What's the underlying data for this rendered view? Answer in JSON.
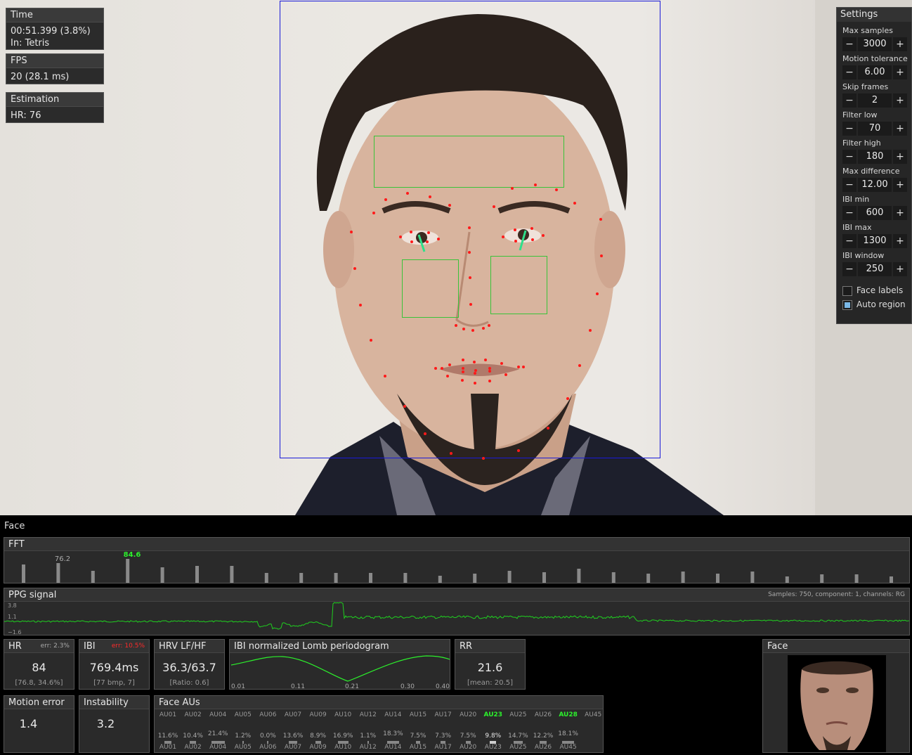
{
  "time_panel": {
    "title": "Time",
    "line1": "00:51.399 (3.8%)",
    "line2": "In: Tetris"
  },
  "fps_panel": {
    "title": "FPS",
    "value": "20 (28.1 ms)"
  },
  "estimation_panel": {
    "title": "Estimation",
    "value": "HR: 76"
  },
  "settings": {
    "title": "Settings",
    "fields": [
      {
        "label": "Max samples",
        "value": "3000"
      },
      {
        "label": "Motion tolerance",
        "value": "6.00"
      },
      {
        "label": "Skip frames",
        "value": "2"
      },
      {
        "label": "Filter low",
        "value": "70"
      },
      {
        "label": "Filter high",
        "value": "180"
      },
      {
        "label": "Max difference",
        "value": "12.00"
      },
      {
        "label": "IBI min",
        "value": "600"
      },
      {
        "label": "IBI max",
        "value": "1300"
      },
      {
        "label": "IBI window",
        "value": "250"
      }
    ],
    "minus": "−",
    "plus": "+",
    "face_labels": {
      "label": "Face labels",
      "checked": false
    },
    "auto_region": {
      "label": "Auto region",
      "checked": true
    }
  },
  "dashboard": {
    "section_label": "Face",
    "fft": {
      "title": "FFT",
      "peak1": "76.2",
      "peak2": "84.6",
      "peak2_color": "#2cf02c"
    },
    "ppg": {
      "title": "PPG signal",
      "info": "Samples: 750, component: 1, channels: RG",
      "y_top": "3.8",
      "y_mid": "1.1",
      "y_bot": "−1.6",
      "line_color": "#1fd01f"
    },
    "hr": {
      "title": "HR",
      "err": "err: 2.3%",
      "value": "84",
      "sub": "[76.8, 34.6%]"
    },
    "ibi": {
      "title": "IBI",
      "err": "err: 10.5%",
      "value": "769.4ms",
      "sub": "[77 bmp, 7]"
    },
    "hrv": {
      "title": "HRV LF/HF",
      "value": "36.3/63.7",
      "sub": "[Ratio: 0.6]"
    },
    "lomb": {
      "title": "IBI normalized Lomb periodogram",
      "ticks": [
        "0.01",
        "0.11",
        "0.21",
        "0.30",
        "0.40"
      ]
    },
    "rr": {
      "title": "RR",
      "value": "21.6",
      "sub": "[mean: 20.5]"
    },
    "face": {
      "title": "Face"
    },
    "motion_error": {
      "title": "Motion error",
      "value": "1.4"
    },
    "instability": {
      "title": "Instability",
      "value": "3.2"
    },
    "face_aus": {
      "title": "Face AUs",
      "top_labels": [
        "AU01",
        "AU02",
        "AU04",
        "AU05",
        "AU06",
        "AU07",
        "AU09",
        "AU10",
        "AU12",
        "AU14",
        "AU15",
        "AU17",
        "AU20",
        "AU23",
        "AU25",
        "AU26",
        "AU28",
        "AU45"
      ],
      "top_highlight": [
        "AU23",
        "AU28"
      ],
      "bars": [
        {
          "label": "AU01",
          "pct": "11.6%",
          "level": 11.6
        },
        {
          "label": "AU02",
          "pct": "10.4%",
          "level": 10.4
        },
        {
          "label": "AU04",
          "pct": "21.4%",
          "level": 21.4
        },
        {
          "label": "AU05",
          "pct": "1.2%",
          "level": 1.2
        },
        {
          "label": "AU06",
          "pct": "0.0%",
          "level": 0.0
        },
        {
          "label": "AU07",
          "pct": "13.6%",
          "level": 13.6
        },
        {
          "label": "AU09",
          "pct": "8.9%",
          "level": 8.9
        },
        {
          "label": "AU10",
          "pct": "16.9%",
          "level": 16.9
        },
        {
          "label": "AU12",
          "pct": "1.1%",
          "level": 1.1
        },
        {
          "label": "AU14",
          "pct": "18.3%",
          "level": 18.3
        },
        {
          "label": "AU15",
          "pct": "7.5%",
          "level": 7.5
        },
        {
          "label": "AU17",
          "pct": "7.3%",
          "level": 7.3
        },
        {
          "label": "AU20",
          "pct": "7.5%",
          "level": 7.5
        },
        {
          "label": "AU23",
          "pct": "9.8%",
          "level": 9.8
        },
        {
          "label": "AU25",
          "pct": "14.7%",
          "level": 14.7
        },
        {
          "label": "AU26",
          "pct": "12.2%",
          "level": 12.2
        },
        {
          "label": "AU45",
          "pct": "18.1%",
          "level": 18.1
        }
      ],
      "bar_highlight": "AU23"
    }
  },
  "colors": {
    "face_box": "#1a1ad8",
    "roi_box": "#39c339",
    "landmark": "#ff1a1a",
    "gaze": "#2fe08a"
  }
}
